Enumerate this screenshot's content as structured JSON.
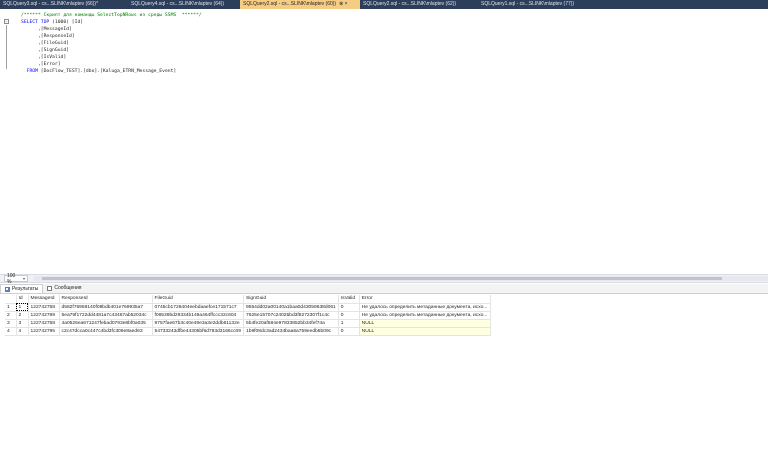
{
  "tabs": [
    {
      "label": "SQLQuery3.sql - cs...SLINK\\mlaptev (66))*",
      "active": false
    },
    {
      "label": "SQLQuery4.sql - cs...SLINK\\mlaptev (64))",
      "active": false
    },
    {
      "label": "SQLQuery2.sql - cs...SLINK\\mlaptev (60))",
      "active": true,
      "close": "⊗ ×"
    },
    {
      "label": "SQLQuery2.sql - cs...SLINK\\mlaptev (62))",
      "active": false
    },
    {
      "label": "SQLQuery1.sql - cs...SLINK\\mlaptev (77))",
      "active": false
    }
  ],
  "code": {
    "comment": "/****** Скрипт для команды SelectTopNRows из среды SSMS  ******/",
    "select_kw": "SELECT",
    "top_kw": "TOP",
    "top_val": " (1000) [Id]",
    "columns": [
      ",[MessageId]",
      ",[ResponseId]",
      ",[FileGuid]",
      ",[SignGuid]",
      ",[IsValid]",
      ",[Error]"
    ],
    "from_kw": "FROM",
    "from_val": " [DocFlow_TEST].[dbo].[Kaluga_ETRN_Message_Event]"
  },
  "zoom": "100 %",
  "result_tabs": [
    {
      "label": "Результаты",
      "icon": "grid-icon"
    },
    {
      "label": "Сообщения",
      "icon": "message-icon"
    }
  ],
  "grid": {
    "headers": [
      "Id",
      "MessageId",
      "ResponseId",
      "FileGuid",
      "SignGuid",
      "IsValid",
      "Error"
    ],
    "rows": [
      {
        "n": "1",
        "cells": [
          "1",
          "122742758",
          "d582f76959140f08bdb401e769935a7",
          "0745cb1728404eebdaaefce171571c7",
          "9554dd02a00140a1baa0d43059638d061",
          "0",
          "Не удалось определить метаданные документа, исхо..."
        ]
      },
      {
        "n": "2",
        "cells": [
          "2",
          "122742789",
          "5ea79f1722dd4481a7c43467ab52034c",
          "f06539bd29334b149a464ffccc32c604",
          "7625e15707c24025bd3f8272307f1c4c",
          "0",
          "Не удалось определить метаданные документа, исхо..."
        ]
      },
      {
        "n": "3",
        "cells": [
          "3",
          "122742758",
          "4a0526ea671247febad0793e8bf0a035",
          "9757fae67b3c40e49e3a3e2ddb61132e",
          "5b4fe20af584e97833852bb34fef74a",
          "1",
          "NULL"
        ]
      },
      {
        "n": "4",
        "cells": [
          "4",
          "122742795",
          "c2c47dcca0c447c4bd3fc309e8aed63",
          "54733243dfbe44305bf6d783d3166cc09",
          "1b9f08dc3ad2434baa6a759eedb5b09c",
          "0",
          "NULL"
        ]
      }
    ]
  },
  "colors": {
    "tabstrip": "#2d3e5a",
    "active_tab": "#f5cc84",
    "null_cell": "#ffffe1",
    "keyword": "#0000ff",
    "comment": "#008000"
  }
}
